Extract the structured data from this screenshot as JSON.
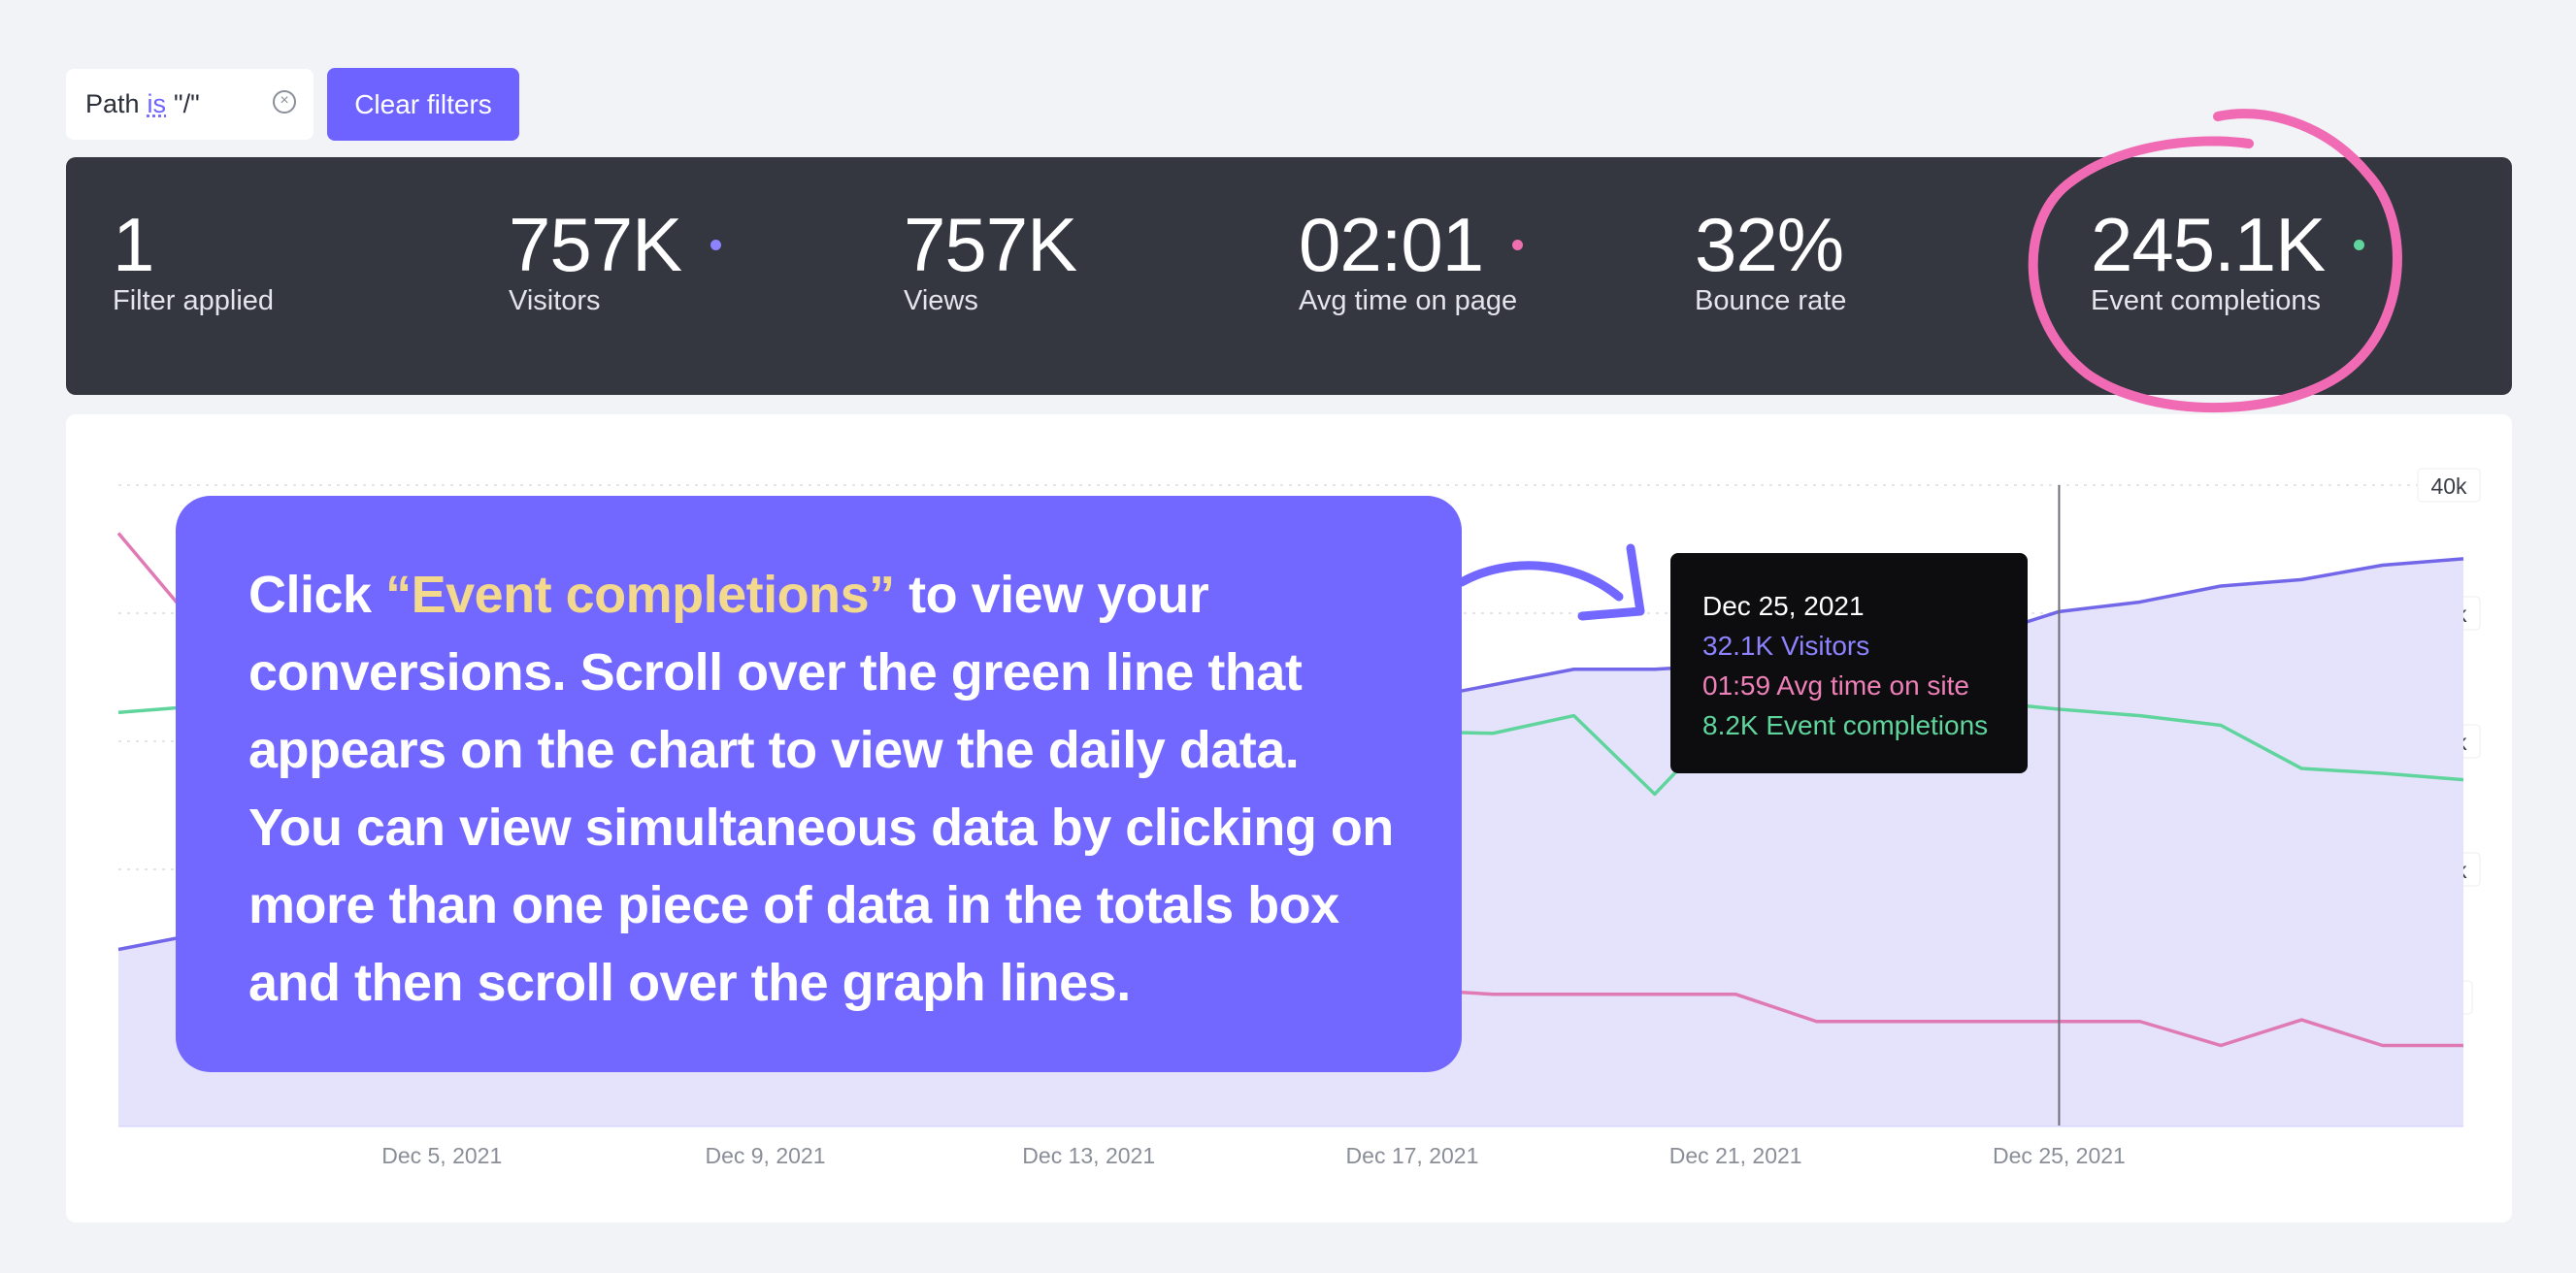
{
  "filter": {
    "field": "Path",
    "operator": "is",
    "value": "\"/\"",
    "clear_label": "Clear filters"
  },
  "stats": [
    {
      "value": "1",
      "label": "Filter applied",
      "dot": ""
    },
    {
      "value": "757K",
      "label": "Visitors",
      "dot": "#8d83ff"
    },
    {
      "value": "757K",
      "label": "Views",
      "dot": ""
    },
    {
      "value": "02:01",
      "label": "Avg time on page",
      "dot": "#ee6fb0"
    },
    {
      "value": "32%",
      "label": "Bounce rate",
      "dot": ""
    },
    {
      "value": "245.1K",
      "label": "Event completions",
      "dot": "#5fd59d"
    }
  ],
  "callout": {
    "prefix": "Click ",
    "highlight": "“Event completions”",
    "suffix": " to view your conversions. Scroll over the green line that appears on the chart to view the daily data. You can view simultaneous data by clicking on more than one piece of data in the totals box and then scroll over the graph lines."
  },
  "tooltip": {
    "date": "Dec 25, 2021",
    "visitors": "32.1K Visitors",
    "avg_time": "01:59 Avg time on site",
    "events": "8.2K Event completions"
  },
  "colors": {
    "accent": "#6f63ff",
    "visitors": "#7267e8",
    "avg_time": "#e07ab5",
    "events": "#5fd59d",
    "annotation": "#f06bb4"
  },
  "chart_data": {
    "type": "line",
    "x_ticks": [
      "Dec 5, 2021",
      "Dec 9, 2021",
      "Dec 13, 2021",
      "Dec 17, 2021",
      "Dec 21, 2021",
      "Dec 25, 2021"
    ],
    "y_ticks": [
      "40k",
      "32k",
      "24k",
      "16k",
      "8k"
    ],
    "ylim": [
      0,
      40000
    ],
    "hover_date": "Dec 25, 2021",
    "series": [
      {
        "name": "Visitors",
        "color": "#7267e8",
        "area": true,
        "points": [
          [
            1,
            11000
          ],
          [
            19,
            28500
          ],
          [
            20,
            28500
          ],
          [
            21,
            28800
          ],
          [
            22,
            29500
          ],
          [
            23,
            30000
          ],
          [
            24,
            30500
          ],
          [
            25,
            32100
          ],
          [
            26,
            32700
          ],
          [
            27,
            33700
          ],
          [
            28,
            34100
          ],
          [
            29,
            35000
          ],
          [
            30,
            35400
          ]
        ]
      },
      {
        "name": "Avg time on site",
        "color": "#e07ab5",
        "points": [
          [
            1,
            37000
          ],
          [
            2,
            31000
          ],
          [
            17,
            8500
          ],
          [
            18,
            8200
          ],
          [
            19,
            8200
          ],
          [
            20,
            8200
          ],
          [
            21,
            8200
          ],
          [
            22,
            6500
          ],
          [
            23,
            6500
          ],
          [
            24,
            6500
          ],
          [
            25,
            6500
          ],
          [
            26,
            6500
          ],
          [
            27,
            5000
          ],
          [
            28,
            6600
          ],
          [
            29,
            5000
          ],
          [
            30,
            5000
          ]
        ]
      },
      {
        "name": "Event completions",
        "color": "#5fd59d",
        "points": [
          [
            1,
            25800
          ],
          [
            2,
            26200
          ],
          [
            18,
            24500
          ],
          [
            19,
            25600
          ],
          [
            20,
            20700
          ],
          [
            21,
            26000
          ],
          [
            22,
            26300
          ],
          [
            23,
            26200
          ],
          [
            24,
            26500
          ],
          [
            25,
            26000
          ],
          [
            26,
            25600
          ],
          [
            27,
            25000
          ],
          [
            28,
            22300
          ],
          [
            29,
            22000
          ],
          [
            30,
            21600
          ]
        ]
      }
    ]
  }
}
